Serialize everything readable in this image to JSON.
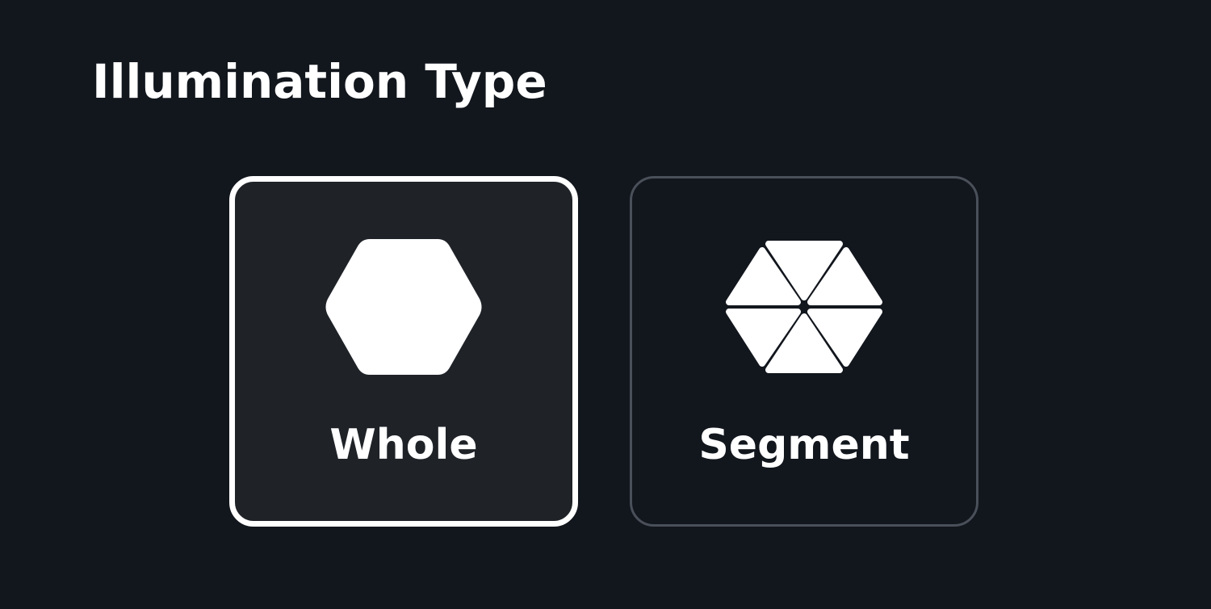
{
  "page": {
    "title": "Illumination Type"
  },
  "options": [
    {
      "label": "Whole",
      "icon": "hexagon-icon",
      "selected": true
    },
    {
      "label": "Segment",
      "icon": "segmented-hexagon-icon",
      "selected": false
    }
  ],
  "colors": {
    "background": "#12161d",
    "selected_card_background": "#1f2328",
    "selected_border": "#ffffff",
    "unselected_border": "#4a5059",
    "text": "#ffffff"
  }
}
